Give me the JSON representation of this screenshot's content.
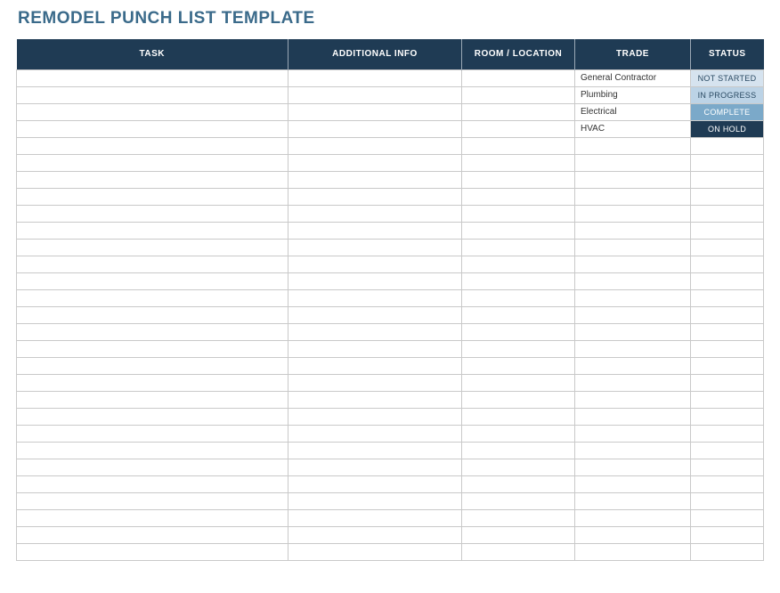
{
  "title": "REMODEL PUNCH LIST TEMPLATE",
  "columns": {
    "task": "TASK",
    "info": "ADDITIONAL INFO",
    "room": "ROOM / LOCATION",
    "trade": "TRADE",
    "status": "STATUS"
  },
  "trades": [
    "General Contractor",
    "Plumbing",
    "Electrical",
    "HVAC"
  ],
  "statuses": [
    {
      "label": "NOT STARTED",
      "class": "status-not-started"
    },
    {
      "label": "IN PROGRESS",
      "class": "status-in-progress"
    },
    {
      "label": "COMPLETE",
      "class": "status-complete"
    },
    {
      "label": "ON HOLD",
      "class": "status-on-hold"
    }
  ],
  "row_count": 29
}
